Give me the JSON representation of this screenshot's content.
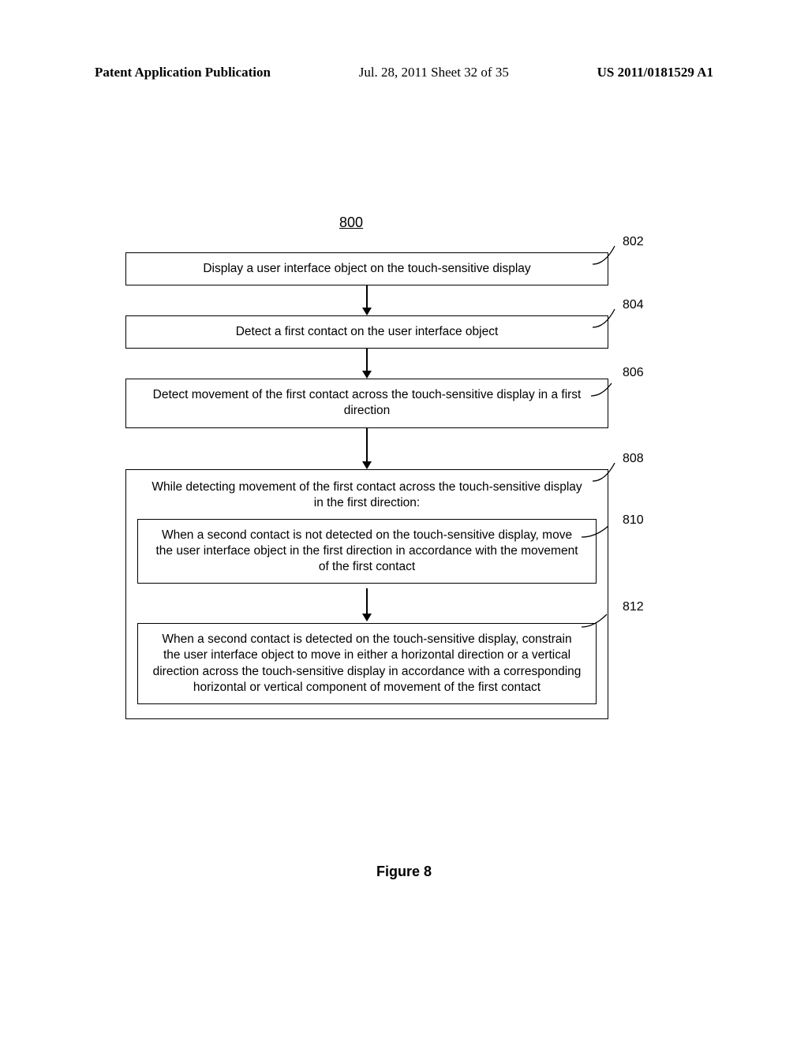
{
  "header": {
    "left": "Patent Application Publication",
    "mid": "Jul. 28, 2011  Sheet 32 of 35",
    "right": "US 2011/0181529 A1"
  },
  "diagram": {
    "number": "800",
    "caption": "Figure 8",
    "boxes": {
      "b802": {
        "ref": "802",
        "text": "Display a user interface object on the touch-sensitive display"
      },
      "b804": {
        "ref": "804",
        "text": "Detect a first contact on the user interface object"
      },
      "b806": {
        "ref": "806",
        "text": "Detect movement of the first contact across the touch-sensitive display in a first direction"
      },
      "b808": {
        "ref": "808",
        "text": "While detecting movement of the first contact across the touch-sensitive display in the first direction:"
      },
      "b810": {
        "ref": "810",
        "text": "When a second contact is not detected on the touch-sensitive display, move the user interface object in the first direction in accordance with the movement of the first contact"
      },
      "b812": {
        "ref": "812",
        "text": "When a second contact is detected on the touch-sensitive display, constrain the user interface object to move in either a horizontal direction or a vertical direction across the touch-sensitive display in accordance with a corresponding horizontal or vertical component of movement of the first contact"
      }
    }
  }
}
